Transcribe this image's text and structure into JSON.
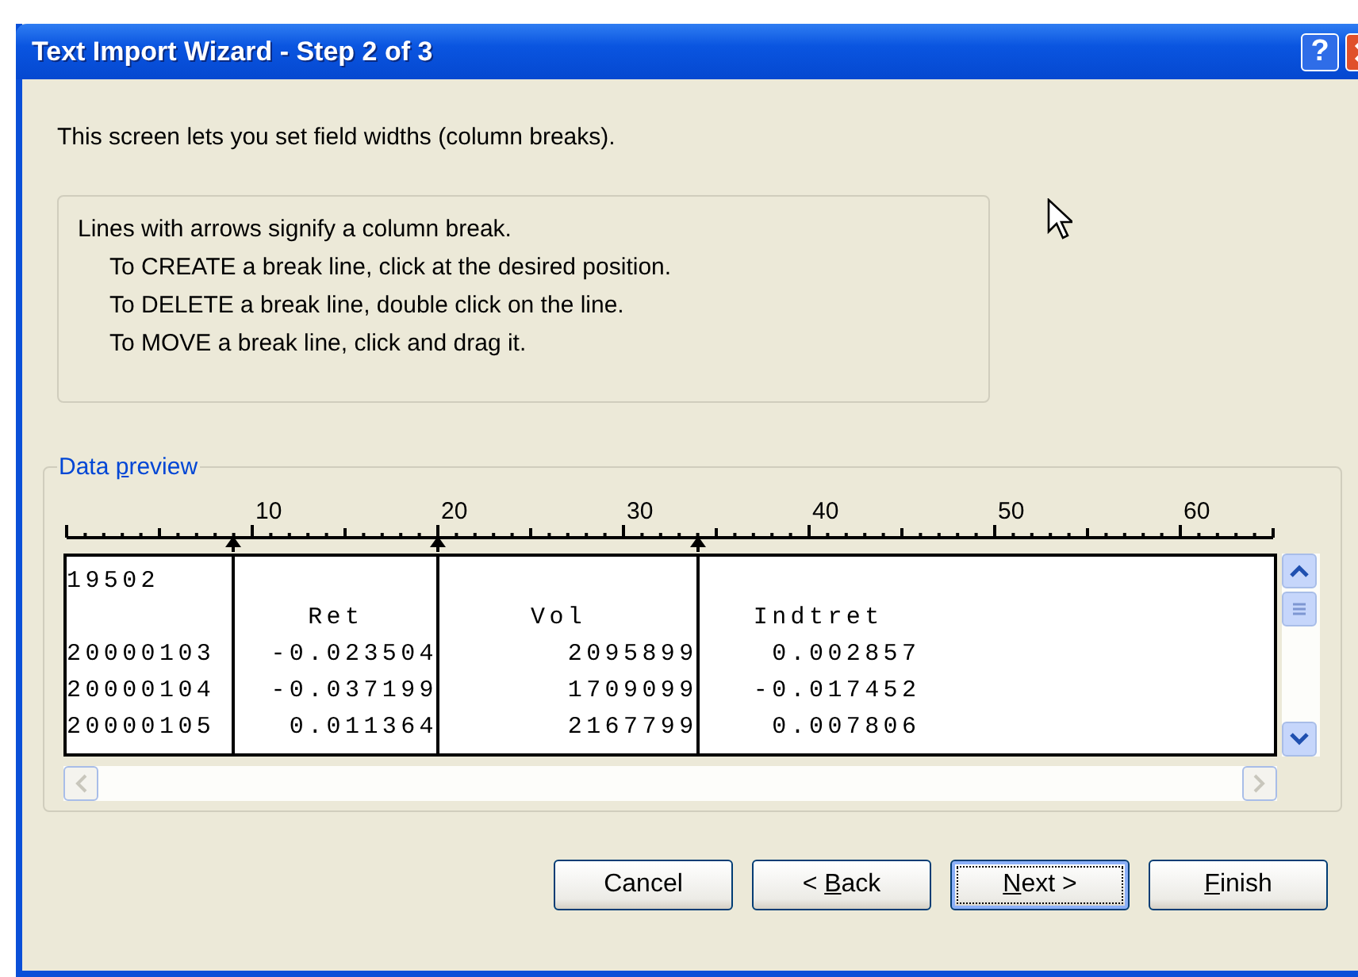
{
  "window": {
    "title": "Text Import Wizard - Step 2 of 3",
    "title_buttons": [
      {
        "kind": "help",
        "label": "?"
      },
      {
        "kind": "close"
      }
    ]
  },
  "intro": "This screen lets you set field widths (column breaks).",
  "instructions": {
    "heading": "Lines with arrows signify a column break.",
    "lines": [
      "To CREATE a break line, click at the desired position.",
      "To DELETE a break line, double click on the line.",
      "To MOVE a break line, click and drag it."
    ]
  },
  "data_preview": {
    "label_parts": {
      "before": "Data ",
      "key": "p",
      "after": "review"
    },
    "ruler_labels": [
      "10",
      "20",
      "30",
      "40",
      "50",
      "60"
    ],
    "rows": [
      [
        "19502"
      ],
      [
        "         ",
        "    Ret    ",
        "     Vol      ",
        "   Indtret"
      ],
      [
        "20000103 ",
        "  -0.023504",
        "       2095899",
        "    0.002857"
      ],
      [
        "20000104 ",
        "  -0.037199",
        "       1709099",
        "   -0.017452"
      ],
      [
        "20000105 ",
        "   0.011364",
        "       2167799",
        "    0.007806"
      ]
    ]
  },
  "buttons": [
    {
      "label_parts": {
        "before": "Cancel"
      },
      "focused": false
    },
    {
      "label_parts": {
        "before": "< ",
        "key": "B",
        "after": "ack"
      },
      "focused": false
    },
    {
      "label_parts": {
        "key": "N",
        "after": "ext >"
      },
      "focused": true
    },
    {
      "label_parts": {
        "key": "F",
        "after": "inish"
      },
      "focused": false
    }
  ]
}
